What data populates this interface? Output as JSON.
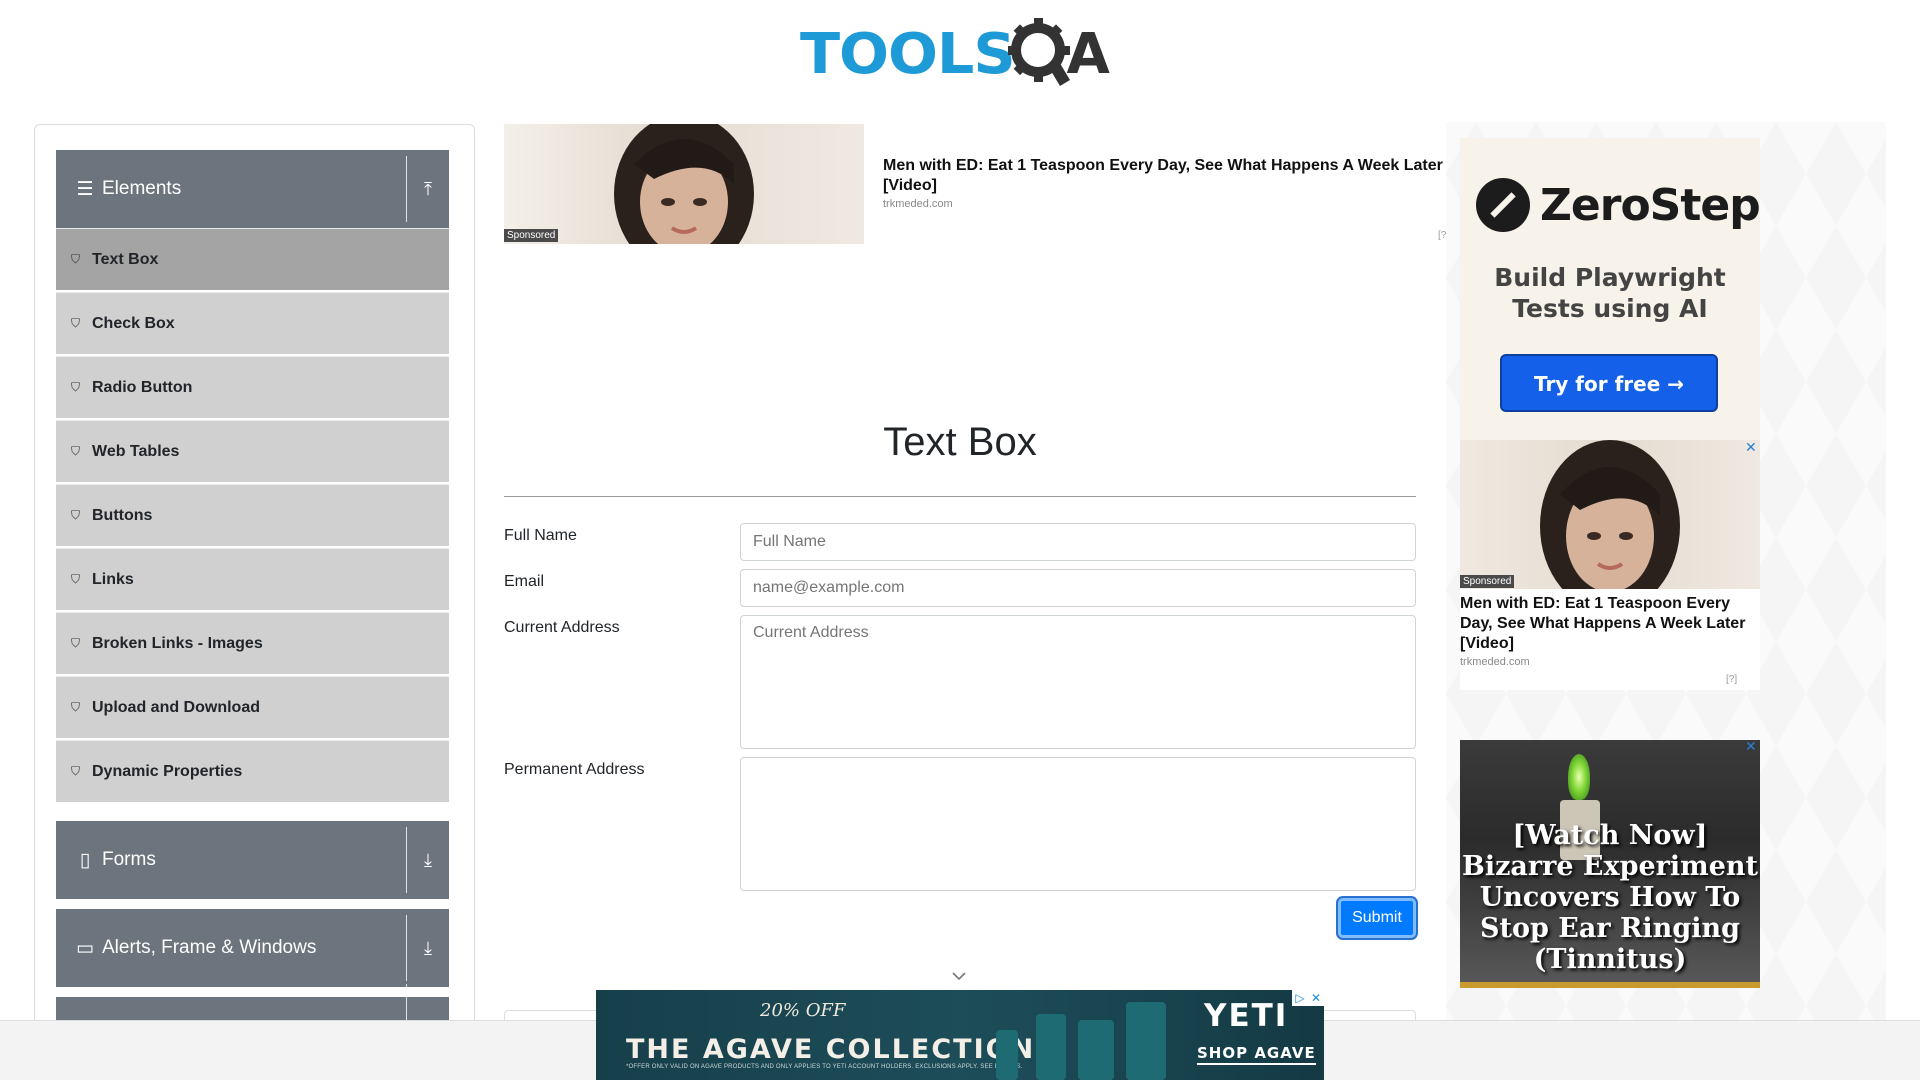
{
  "header": {
    "logo_tools": "TOOLS",
    "logo_qa": "QA"
  },
  "sidebar": {
    "groups": [
      {
        "title": "Elements",
        "icon": "hamburger-icon",
        "arrow": "collapse-up-icon"
      },
      {
        "title": "Forms",
        "icon": "file-icon",
        "arrow": "expand-down-icon"
      },
      {
        "title": "Alerts, Frame & Windows",
        "icon": "window-icon",
        "arrow": "expand-down-icon"
      }
    ],
    "items": [
      {
        "label": "Text Box",
        "icon": "html5-shield-icon",
        "active": true
      },
      {
        "label": "Check Box",
        "icon": "html5-shield-icon"
      },
      {
        "label": "Radio Button",
        "icon": "html5-shield-icon"
      },
      {
        "label": "Web Tables",
        "icon": "html5-shield-icon"
      },
      {
        "label": "Buttons",
        "icon": "html5-shield-icon"
      },
      {
        "label": "Links",
        "icon": "html5-shield-icon"
      },
      {
        "label": "Broken Links - Images",
        "icon": "html5-shield-icon"
      },
      {
        "label": "Upload and Download",
        "icon": "html5-shield-icon"
      },
      {
        "label": "Dynamic Properties",
        "icon": "html5-shield-icon"
      }
    ]
  },
  "top_ad": {
    "sponsored": "Sponsored",
    "headline": "Men with ED: Eat 1 Teaspoon Every Day, See What Happens A Week Later [Video]",
    "domain": "trkmeded.com",
    "flag": "[?"
  },
  "main": {
    "title": "Text Box",
    "full_name_label": "Full Name",
    "full_name_placeholder": "Full Name",
    "email_label": "Email",
    "email_placeholder": "name@example.com",
    "current_address_label": "Current Address",
    "current_address_placeholder": "Current Address",
    "permanent_address_label": "Permanent Address",
    "submit_label": "Submit"
  },
  "right_ads": {
    "zerostep": {
      "brand": "ZeroStep",
      "tagline_line1": "Build Playwright",
      "tagline_line2": "Tests using AI",
      "cta": "Try for free →"
    },
    "ed_ad": {
      "sponsored": "Sponsored",
      "headline": "Men with ED: Eat 1 Teaspoon Every Day, See What Happens A Week Later [Video]",
      "domain": "trkmeded.com",
      "flag": "[?]"
    },
    "tinnitus_ad": {
      "text": "[Watch Now] Bizarre Experiment Uncovers How To Stop Ear Ringing (Tinnitus)"
    }
  },
  "bottom_ad": {
    "discount": "20% OFF",
    "collection": "THE AGAVE COLLECTION",
    "fine_print": "*OFFER ONLY VALID ON AGAVE PRODUCTS AND ONLY APPLIES TO YETI ACCOUNT HOLDERS. EXCLUSIONS APPLY. SEE DETAILS.",
    "brand": "YETI",
    "cta": "SHOP AGAVE"
  },
  "colors": {
    "group_header": "#6c757d",
    "menu_item": "#d0d0d0",
    "menu_active": "#a4a4a4",
    "primary": "#007bff",
    "logo_blue": "#1e9bd7"
  }
}
